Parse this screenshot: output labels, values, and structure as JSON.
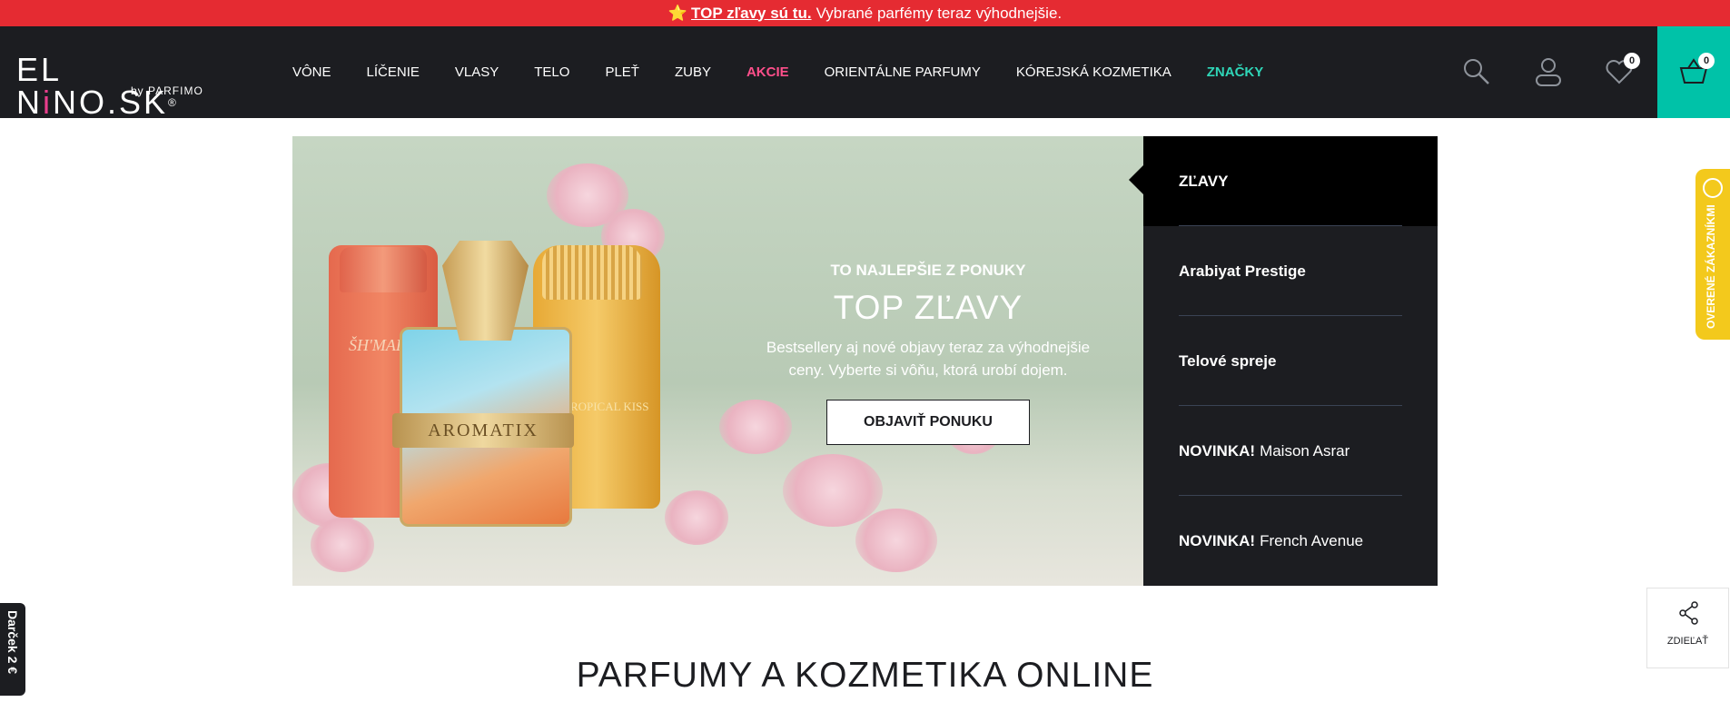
{
  "promo": {
    "star": "⭐",
    "link_text": "TOP zľavy sú tu.",
    "text": "Vybrané parfémy teraz výhodnejšie."
  },
  "logo": {
    "main_before": "EL N",
    "main_pin": "i",
    "main_after": "NO.SK",
    "reg": "®",
    "sub": "by PARFIMO"
  },
  "nav": {
    "items": [
      {
        "label": "VÔNE"
      },
      {
        "label": "LÍČENIE"
      },
      {
        "label": "VLASY"
      },
      {
        "label": "TELO"
      },
      {
        "label": "PLEŤ"
      },
      {
        "label": "ZUBY"
      },
      {
        "label": "AKCIE"
      },
      {
        "label": "ORIENTÁLNE PARFUMY"
      },
      {
        "label": "KÓREJSKÁ KOZMETIKA"
      },
      {
        "label": "ZNAČKY"
      }
    ]
  },
  "header_icons": {
    "wishlist_count": "0",
    "cart_count": "0"
  },
  "hero": {
    "eyebrow": "TO NAJLEPŠIE Z PONUKY",
    "title": "TOP ZĽAVY",
    "description": "Bestsellery aj nové objavy teraz za výhodnejšie ceny. Vyberte si vôňu, ktorá urobí dojem.",
    "button": "OBJAVIŤ PONUKU",
    "bottle_coral_text": "ŠH'MALLO Flo",
    "bottle_gold_text": "TROPICAL KISS",
    "bottle_plate_text": "AROMATIX"
  },
  "hero_menu": {
    "items": [
      {
        "prefix": "",
        "label": "ZĽAVY"
      },
      {
        "prefix": "",
        "label": "Arabiyat Prestige"
      },
      {
        "prefix": "",
        "label": "Telové spreje"
      },
      {
        "prefix": "NOVINKA!",
        "label": "Maison Asrar"
      },
      {
        "prefix": "NOVINKA!",
        "label": "French Avenue"
      }
    ]
  },
  "side_tabs": {
    "verified": "OVERENÉ ZÁKAZNÍKMI",
    "gift": "Darček 2 €"
  },
  "share": {
    "label": "ZDIEĽAŤ"
  },
  "section": {
    "title": "PARFUMY A KOZMETIKA ONLINE"
  },
  "colors": {
    "promo_red": "#e52b32",
    "header_dark": "#1c1d21",
    "cart_teal": "#00c2a8",
    "sale_pink": "#ff4f8b",
    "brands_teal": "#2fd6b8",
    "verified_yellow": "#f3c91c"
  }
}
